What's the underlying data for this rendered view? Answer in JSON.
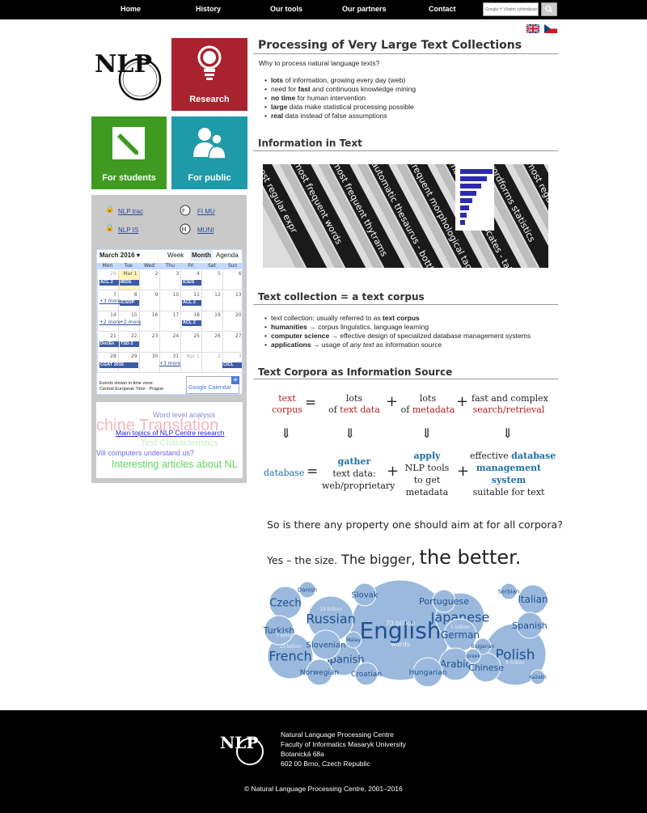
{
  "nav": {
    "items": [
      "Home",
      "History",
      "Our tools",
      "Our partners",
      "Contact"
    ],
    "search_placeholder": "Google™ Vlastní vyhledávání"
  },
  "sidebar": {
    "tiles": {
      "research": "Research",
      "students": "For students",
      "public": "For public"
    },
    "links": {
      "nlp_trac": "NLP trac",
      "fi_mu": "FI MU",
      "nlp_is": "NLP IS",
      "muni": "MUNI"
    },
    "tags": [
      "Word level analysis",
      "chine Translation",
      "Main topics of NLP Centre research",
      "Text Characteristics",
      "Vill computers understand us?",
      "Interesting articles about NL"
    ]
  },
  "calendar": {
    "month": "March 2016",
    "views": [
      "Week",
      "Month",
      "Agenda"
    ],
    "weekdays": [
      "Mon",
      "Tue",
      "Wed",
      "Thu",
      "Fri",
      "Sat",
      "Sun"
    ],
    "days": [
      [
        "29",
        "Mar 1",
        "2",
        "3",
        "4",
        "5",
        "6"
      ],
      [
        "7",
        "8",
        "9",
        "10",
        "11",
        "12",
        "13"
      ],
      [
        "14",
        "15",
        "16",
        "17",
        "18",
        "19",
        "20"
      ],
      [
        "21",
        "22",
        "23",
        "24",
        "25",
        "26",
        "27"
      ],
      [
        "28",
        "29",
        "30",
        "31",
        "Apr 1",
        "2",
        "3"
      ]
    ],
    "events": {
      "acl1": "ACL 2",
      "iros": "IROS",
      "iceis": "ICEIS",
      "icsop": "ICSOP",
      "acl2": "ACL 2",
      "acl3": "ACL 2",
      "doce": "DocEn",
      "tsd": "TSD 2",
      "cgat": "CGAT 2016",
      "cicl": "CICL"
    },
    "more": {
      "w1": "+3 more",
      "w2a": "+2 more",
      "w2b": "+2 more",
      "w4": "+3 more"
    },
    "timezone_label": "Events shown in time zone:",
    "timezone": "Central European Time - Prague",
    "google_label": "Google Calendar"
  },
  "main": {
    "title": "Processing of Very Large Text Collections",
    "why": "Why to process natural language texts?",
    "bullets": [
      {
        "b": "lots",
        "t": " of information, growing every day (web)"
      },
      {
        "b": "fast",
        "pre": "need for ",
        "t": " and continuous knowledge mining"
      },
      {
        "b": "no time",
        "t": " for human intervention"
      },
      {
        "b": "large",
        "t": " data make statistical processing possible"
      },
      {
        "b": "real",
        "t": " data instead of false assumptions"
      }
    ],
    "info_title": "Information in Text",
    "collection_title": "Text collection = a text corpus",
    "collection_bullets": [
      {
        "pre": "text collection: usually referred to as ",
        "b": "text corpus",
        "t": ""
      },
      {
        "b": "humanities",
        "t": " → corpus linguistics, language learning"
      },
      {
        "b": "computer science",
        "t": " → effective design of specialized database management systems"
      },
      {
        "b": "applications",
        "t": " → usage of ",
        "i": "any text",
        "t2": " as information source"
      }
    ],
    "corpora_title": "Text Corpora as Information Source"
  },
  "banner_words": [
    "most regular expr",
    "most frequent words",
    "most frequent thytrams",
    "automatic thesaurus - bottle",
    "frequent morphological tags",
    "most salient collocates - take",
    "wordforms statistics"
  ],
  "slide": {
    "r1": {
      "a1": "text",
      "a2": "corpus",
      "eq": "=",
      "b1": "lots",
      "b2": "of",
      "b3": "text data",
      "c1": "lots",
      "c2": "of",
      "c3": "metadata",
      "d1": "fast and complex",
      "d2": "search/retrieval"
    },
    "r2": {
      "a": "database",
      "b1": "gather",
      "b2": "text data:",
      "b3": "web/proprietary",
      "c1": "apply",
      "c2": "NLP tools",
      "c3": "to get",
      "c4": "metadata",
      "d1": "effective",
      "d2": "database",
      "d3": "management",
      "d4": "system",
      "d5": "suitable for text"
    },
    "q": "So is there any property one should aim at for all corpora?",
    "a1": "Yes – the size.",
    "a2": "The bigger,",
    "a3": "the better."
  },
  "bubbles": {
    "labels": [
      "English",
      "Russian",
      "Japanese",
      "Polish",
      "French",
      "Spanish",
      "Czech",
      "Portuguese",
      "German",
      "Italian",
      "Turkish",
      "Slovenian",
      "Arabic",
      "Chinese",
      "Slovak",
      "Norwegian",
      "Croatian",
      "Hungarian",
      "Danish",
      "Serbian",
      "Malay",
      "Bulgarian",
      "Greek",
      "Kazakh",
      "Spanish"
    ],
    "notes": [
      "70 billion",
      "words",
      "15 billion",
      "10 billion",
      "8 billion",
      "5 billion",
      "3 billion"
    ]
  },
  "footer": {
    "lines": [
      "Natural Language Processing Centre",
      "Faculty of Informatics Masaryk University",
      "Botanická 68a",
      "602 00 Brno, Czech Republic"
    ],
    "copyright": "© Natural Language Processing Centre, 2001–2016"
  },
  "colors": {
    "research": "#a8232d",
    "students": "#3e9b20",
    "public": "#1e9aa9",
    "blue": "#1e6fa6",
    "red": "#b22222",
    "bubble": "#9ab9dc"
  }
}
